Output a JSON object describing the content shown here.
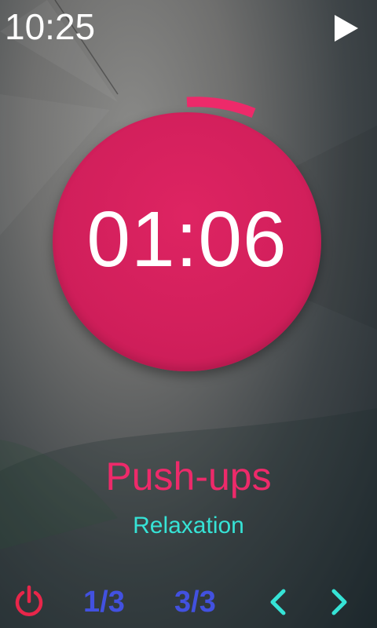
{
  "status": {
    "time": "10:25"
  },
  "timer": {
    "value": "01:06"
  },
  "exercise": {
    "name": "Push-ups",
    "phase": "Relaxation"
  },
  "bottom_bar": {
    "round_counter": "1/3",
    "set_counter": "3/3"
  },
  "icons": {
    "play": "play-icon",
    "power": "power-icon",
    "prev": "chevron-left-icon",
    "next": "chevron-right-icon"
  },
  "colors": {
    "accent_pink": "#ED2A6A",
    "timer_circle": "#D11F5B",
    "phase_cyan": "#36E3D6",
    "counter_blue": "#4251E0",
    "power_red": "#E8264A"
  }
}
